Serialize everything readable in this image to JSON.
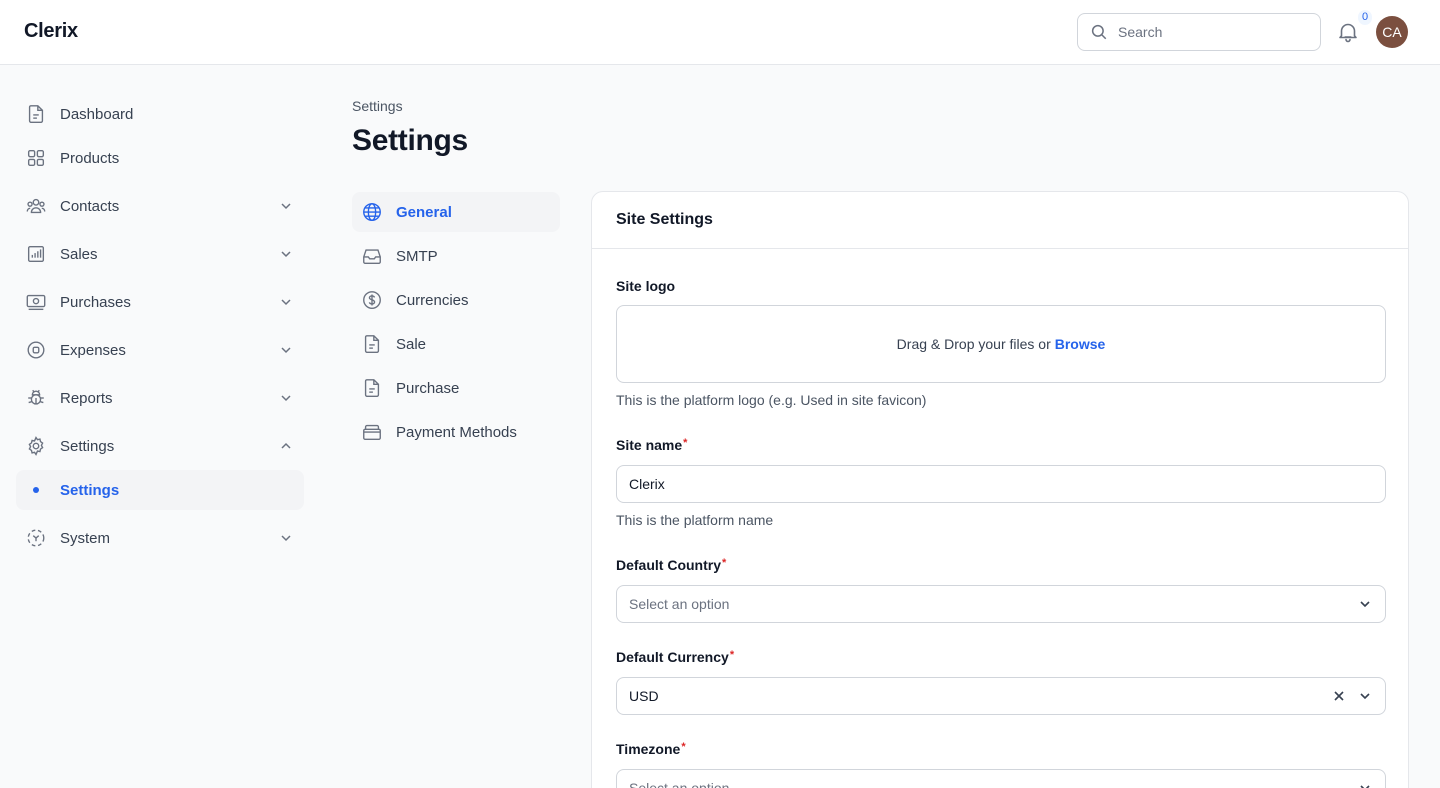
{
  "header": {
    "brand": "Clerix",
    "search_placeholder": "Search",
    "notification_count": "0",
    "avatar_initials": "CA"
  },
  "sidebar": {
    "items": [
      {
        "label": "Dashboard",
        "icon": "document-icon"
      },
      {
        "label": "Products",
        "icon": "grid-icon"
      },
      {
        "label": "Contacts",
        "icon": "users-icon"
      },
      {
        "label": "Sales",
        "icon": "chart-icon"
      },
      {
        "label": "Purchases",
        "icon": "cash-icon"
      },
      {
        "label": "Expenses",
        "icon": "circle-stop-icon"
      },
      {
        "label": "Reports",
        "icon": "bug-icon"
      },
      {
        "label": "Settings",
        "icon": "gear-icon"
      },
      {
        "label": "Settings",
        "icon": "dot-icon"
      },
      {
        "label": "System",
        "icon": "viewfinder-icon"
      }
    ]
  },
  "breadcrumb": "Settings",
  "page_title": "Settings",
  "subnav": {
    "items": [
      {
        "label": "General",
        "icon": "globe-icon"
      },
      {
        "label": "SMTP",
        "icon": "inbox-icon"
      },
      {
        "label": "Currencies",
        "icon": "dollar-circle-icon"
      },
      {
        "label": "Sale",
        "icon": "document-icon"
      },
      {
        "label": "Purchase",
        "icon": "document-icon"
      },
      {
        "label": "Payment Methods",
        "icon": "stack-icon"
      }
    ]
  },
  "panel": {
    "title": "Site Settings",
    "site_logo": {
      "label": "Site logo",
      "drop_text": "Drag & Drop your files or",
      "browse": "Browse",
      "helper": "This is the platform logo (e.g. Used in site favicon)"
    },
    "site_name": {
      "label": "Site name",
      "required": "*",
      "value": "Clerix",
      "helper": "This is the platform name"
    },
    "default_country": {
      "label": "Default Country",
      "required": "*",
      "placeholder": "Select an option"
    },
    "default_currency": {
      "label": "Default Currency",
      "required": "*",
      "value": "USD"
    },
    "timezone": {
      "label": "Timezone",
      "required": "*",
      "placeholder": "Select an option"
    }
  },
  "colors": {
    "accent": "#2563eb",
    "required": "#dc2626",
    "avatar_bg": "#7b4f3f"
  }
}
